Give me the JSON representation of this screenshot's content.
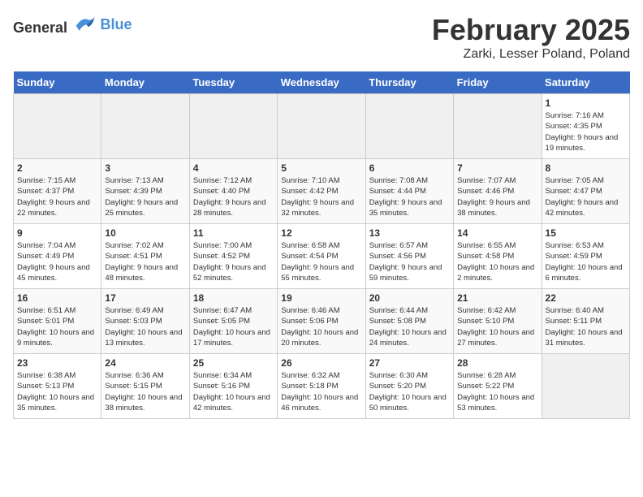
{
  "header": {
    "logo_general": "General",
    "logo_blue": "Blue",
    "title": "February 2025",
    "subtitle": "Zarki, Lesser Poland, Poland"
  },
  "days_of_week": [
    "Sunday",
    "Monday",
    "Tuesday",
    "Wednesday",
    "Thursday",
    "Friday",
    "Saturday"
  ],
  "weeks": [
    [
      {
        "day": "",
        "info": ""
      },
      {
        "day": "",
        "info": ""
      },
      {
        "day": "",
        "info": ""
      },
      {
        "day": "",
        "info": ""
      },
      {
        "day": "",
        "info": ""
      },
      {
        "day": "",
        "info": ""
      },
      {
        "day": "1",
        "info": "Sunrise: 7:16 AM\nSunset: 4:35 PM\nDaylight: 9 hours and 19 minutes."
      }
    ],
    [
      {
        "day": "2",
        "info": "Sunrise: 7:15 AM\nSunset: 4:37 PM\nDaylight: 9 hours and 22 minutes."
      },
      {
        "day": "3",
        "info": "Sunrise: 7:13 AM\nSunset: 4:39 PM\nDaylight: 9 hours and 25 minutes."
      },
      {
        "day": "4",
        "info": "Sunrise: 7:12 AM\nSunset: 4:40 PM\nDaylight: 9 hours and 28 minutes."
      },
      {
        "day": "5",
        "info": "Sunrise: 7:10 AM\nSunset: 4:42 PM\nDaylight: 9 hours and 32 minutes."
      },
      {
        "day": "6",
        "info": "Sunrise: 7:08 AM\nSunset: 4:44 PM\nDaylight: 9 hours and 35 minutes."
      },
      {
        "day": "7",
        "info": "Sunrise: 7:07 AM\nSunset: 4:46 PM\nDaylight: 9 hours and 38 minutes."
      },
      {
        "day": "8",
        "info": "Sunrise: 7:05 AM\nSunset: 4:47 PM\nDaylight: 9 hours and 42 minutes."
      }
    ],
    [
      {
        "day": "9",
        "info": "Sunrise: 7:04 AM\nSunset: 4:49 PM\nDaylight: 9 hours and 45 minutes."
      },
      {
        "day": "10",
        "info": "Sunrise: 7:02 AM\nSunset: 4:51 PM\nDaylight: 9 hours and 48 minutes."
      },
      {
        "day": "11",
        "info": "Sunrise: 7:00 AM\nSunset: 4:52 PM\nDaylight: 9 hours and 52 minutes."
      },
      {
        "day": "12",
        "info": "Sunrise: 6:58 AM\nSunset: 4:54 PM\nDaylight: 9 hours and 55 minutes."
      },
      {
        "day": "13",
        "info": "Sunrise: 6:57 AM\nSunset: 4:56 PM\nDaylight: 9 hours and 59 minutes."
      },
      {
        "day": "14",
        "info": "Sunrise: 6:55 AM\nSunset: 4:58 PM\nDaylight: 10 hours and 2 minutes."
      },
      {
        "day": "15",
        "info": "Sunrise: 6:53 AM\nSunset: 4:59 PM\nDaylight: 10 hours and 6 minutes."
      }
    ],
    [
      {
        "day": "16",
        "info": "Sunrise: 6:51 AM\nSunset: 5:01 PM\nDaylight: 10 hours and 9 minutes."
      },
      {
        "day": "17",
        "info": "Sunrise: 6:49 AM\nSunset: 5:03 PM\nDaylight: 10 hours and 13 minutes."
      },
      {
        "day": "18",
        "info": "Sunrise: 6:47 AM\nSunset: 5:05 PM\nDaylight: 10 hours and 17 minutes."
      },
      {
        "day": "19",
        "info": "Sunrise: 6:46 AM\nSunset: 5:06 PM\nDaylight: 10 hours and 20 minutes."
      },
      {
        "day": "20",
        "info": "Sunrise: 6:44 AM\nSunset: 5:08 PM\nDaylight: 10 hours and 24 minutes."
      },
      {
        "day": "21",
        "info": "Sunrise: 6:42 AM\nSunset: 5:10 PM\nDaylight: 10 hours and 27 minutes."
      },
      {
        "day": "22",
        "info": "Sunrise: 6:40 AM\nSunset: 5:11 PM\nDaylight: 10 hours and 31 minutes."
      }
    ],
    [
      {
        "day": "23",
        "info": "Sunrise: 6:38 AM\nSunset: 5:13 PM\nDaylight: 10 hours and 35 minutes."
      },
      {
        "day": "24",
        "info": "Sunrise: 6:36 AM\nSunset: 5:15 PM\nDaylight: 10 hours and 38 minutes."
      },
      {
        "day": "25",
        "info": "Sunrise: 6:34 AM\nSunset: 5:16 PM\nDaylight: 10 hours and 42 minutes."
      },
      {
        "day": "26",
        "info": "Sunrise: 6:32 AM\nSunset: 5:18 PM\nDaylight: 10 hours and 46 minutes."
      },
      {
        "day": "27",
        "info": "Sunrise: 6:30 AM\nSunset: 5:20 PM\nDaylight: 10 hours and 50 minutes."
      },
      {
        "day": "28",
        "info": "Sunrise: 6:28 AM\nSunset: 5:22 PM\nDaylight: 10 hours and 53 minutes."
      },
      {
        "day": "",
        "info": ""
      }
    ]
  ]
}
